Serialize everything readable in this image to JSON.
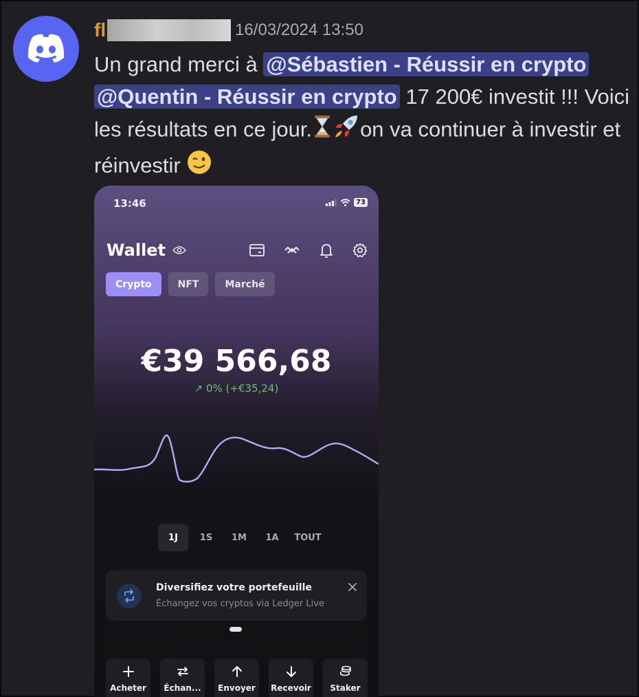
{
  "message": {
    "author": "fl",
    "timestamp": "16/03/2024 13:50",
    "text_1": "Un grand merci à ",
    "mention_1": "@Sébastien - Réussir en crypto",
    "mention_2": "@Quentin - Réussir en crypto",
    "text_2": " 17 200€ investit !!! Voici les résultats en ce jour.",
    "text_3": "on va continuer à investir et réinvestir ",
    "emojis": [
      "hourglass-emoji",
      "rocket-emoji",
      "winking-face-emoji"
    ]
  },
  "phone": {
    "status_time": "13:46",
    "battery": "73",
    "title": "Wallet",
    "tabs": [
      {
        "label": "Crypto",
        "active": true
      },
      {
        "label": "NFT",
        "active": false
      },
      {
        "label": "Marché",
        "active": false
      }
    ],
    "balance": "€39 566,68",
    "change": "↗ 0% (+€35,24)",
    "ranges": [
      "1J",
      "1S",
      "1M",
      "1A",
      "TOUT"
    ],
    "active_range": "1J",
    "banner": {
      "title": "Diversifiez votre portefeuille",
      "subtitle": "Échangez vos cryptos via Ledger Live"
    },
    "actions": [
      "Acheter",
      "Échan...",
      "Envoyer",
      "Recevoir",
      "Staker"
    ]
  },
  "colors": {
    "background": "#1f1f23",
    "author": "#d99a37",
    "mention_bg": "#3c4087",
    "accent": "#9d8ef4",
    "positive": "#6bbd77",
    "chart_line": "#b8a8f8"
  }
}
